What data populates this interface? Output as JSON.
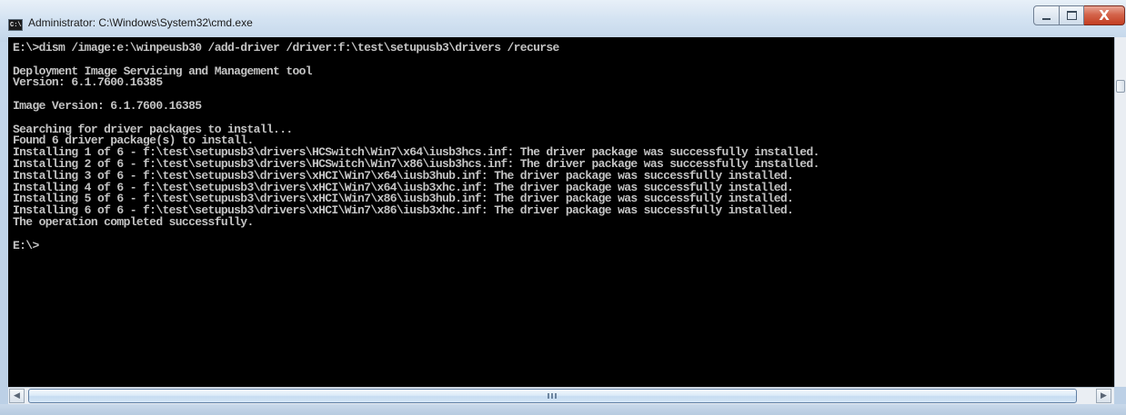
{
  "window": {
    "title": "Administrator: C:\\Windows\\System32\\cmd.exe",
    "icon": "cmd-icon",
    "icon_text": "C:\\",
    "controls": {
      "minimize": "minimize-icon",
      "maximize": "maximize-icon",
      "close": "close-icon",
      "close_glyph": "X"
    }
  },
  "console": {
    "lines": [
      "E:\\>dism /image:e:\\winpeusb30 /add-driver /driver:f:\\test\\setupusb3\\drivers /recurse",
      "",
      "Deployment Image Servicing and Management tool",
      "Version: 6.1.7600.16385",
      "",
      "Image Version: 6.1.7600.16385",
      "",
      "Searching for driver packages to install...",
      "Found 6 driver package(s) to install.",
      "Installing 1 of 6 - f:\\test\\setupusb3\\drivers\\HCSwitch\\Win7\\x64\\iusb3hcs.inf: The driver package was successfully installed.",
      "Installing 2 of 6 - f:\\test\\setupusb3\\drivers\\HCSwitch\\Win7\\x86\\iusb3hcs.inf: The driver package was successfully installed.",
      "Installing 3 of 6 - f:\\test\\setupusb3\\drivers\\xHCI\\Win7\\x64\\iusb3hub.inf: The driver package was successfully installed.",
      "Installing 4 of 6 - f:\\test\\setupusb3\\drivers\\xHCI\\Win7\\x64\\iusb3xhc.inf: The driver package was successfully installed.",
      "Installing 5 of 6 - f:\\test\\setupusb3\\drivers\\xHCI\\Win7\\x86\\iusb3hub.inf: The driver package was successfully installed.",
      "Installing 6 of 6 - f:\\test\\setupusb3\\drivers\\xHCI\\Win7\\x86\\iusb3xhc.inf: The driver package was successfully installed.",
      "The operation completed successfully.",
      "",
      "E:\\>"
    ],
    "text_color": "#c4c4c4",
    "background": "#000000"
  },
  "scrollbars": {
    "left_arrow": "◀",
    "right_arrow": "▶",
    "grip": "III"
  }
}
